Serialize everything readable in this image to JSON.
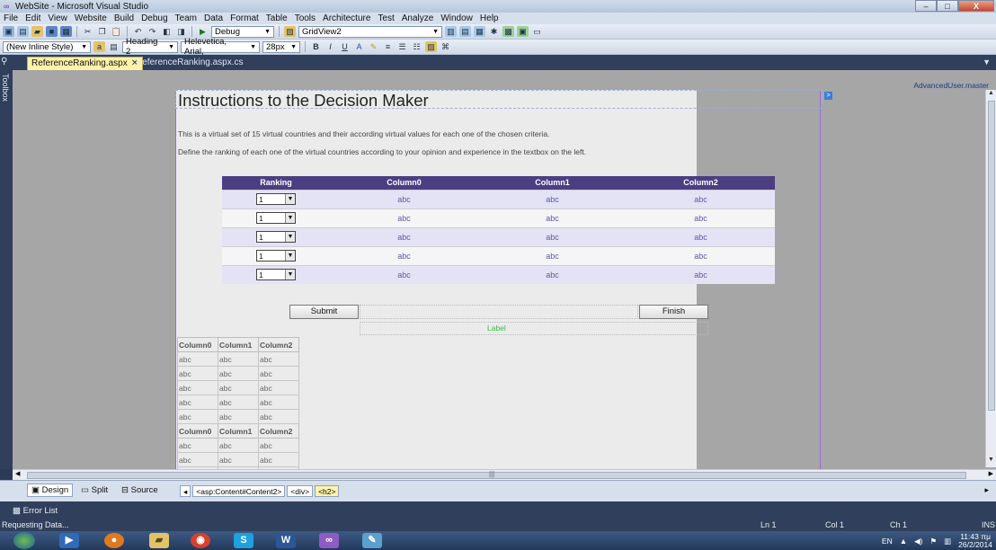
{
  "window": {
    "title": "WebSite - Microsoft Visual Studio",
    "minimize": "–",
    "maximize": "□",
    "close": "X"
  },
  "menu": [
    "File",
    "Edit",
    "View",
    "Website",
    "Build",
    "Debug",
    "Team",
    "Data",
    "Format",
    "Table",
    "Tools",
    "Architecture",
    "Test",
    "Analyze",
    "Window",
    "Help"
  ],
  "toolbar1": {
    "config": "Debug",
    "target": "GridView2"
  },
  "toolbar2": {
    "style": "(New Inline Style)",
    "block_format": "Heading 2",
    "font": "Helevetica, Arial,",
    "size": "28px",
    "bold": "B",
    "italic": "I",
    "underline": "U"
  },
  "tabs": {
    "active": "ReferenceRanking.aspx",
    "inactive": "ReferenceRanking.aspx.cs",
    "close": "✕"
  },
  "toolbox_label": "Toolbox",
  "master_label": "AdvancedUser.master",
  "page": {
    "heading": "Instructions to the Decision Maker",
    "instruction1": "This is a virtual set of 15 virtual countries and their according virtual values for each one of the chosen criteria.",
    "instruction2": "Define the ranking of each one of the virtual countries according to your opinion and experience in the textbox on the left.",
    "grid": {
      "headers": [
        "Ranking",
        "Column0",
        "Column1",
        "Column2"
      ],
      "rows": [
        {
          "rank": "1",
          "c0": "abc",
          "c1": "abc",
          "c2": "abc"
        },
        {
          "rank": "1",
          "c0": "abc",
          "c1": "abc",
          "c2": "abc"
        },
        {
          "rank": "1",
          "c0": "abc",
          "c1": "abc",
          "c2": "abc"
        },
        {
          "rank": "1",
          "c0": "abc",
          "c1": "abc",
          "c2": "abc"
        },
        {
          "rank": "1",
          "c0": "abc",
          "c1": "abc",
          "c2": "abc"
        }
      ]
    },
    "submit": "Submit",
    "finish": "Finish",
    "label": "Label",
    "grid2": {
      "headers": [
        "Column0",
        "Column1",
        "Column2"
      ],
      "rows_a": [
        [
          "abc",
          "abc",
          "abc"
        ],
        [
          "abc",
          "abc",
          "abc"
        ],
        [
          "abc",
          "abc",
          "abc"
        ],
        [
          "abc",
          "abc",
          "abc"
        ],
        [
          "abc",
          "abc",
          "abc"
        ]
      ],
      "rows_b": [
        [
          "abc",
          "abc",
          "abc"
        ],
        [
          "abc",
          "abc",
          "abc"
        ],
        [
          "abc",
          "abc",
          "abc"
        ]
      ]
    }
  },
  "viewbar": {
    "design": "Design",
    "split": "Split",
    "source": "Source",
    "crumb1": "<asp:Content#Content2>",
    "crumb2": "<div>",
    "crumb3": "<h2>"
  },
  "errorlist": "Error List",
  "status": {
    "left": "Requesting Data...",
    "ln": "Ln 1",
    "col": "Col 1",
    "ch": "Ch 1",
    "ins": "INS"
  },
  "taskbar": {
    "lang": "EN",
    "time": "11:43 πμ",
    "date": "26/2/2014"
  }
}
